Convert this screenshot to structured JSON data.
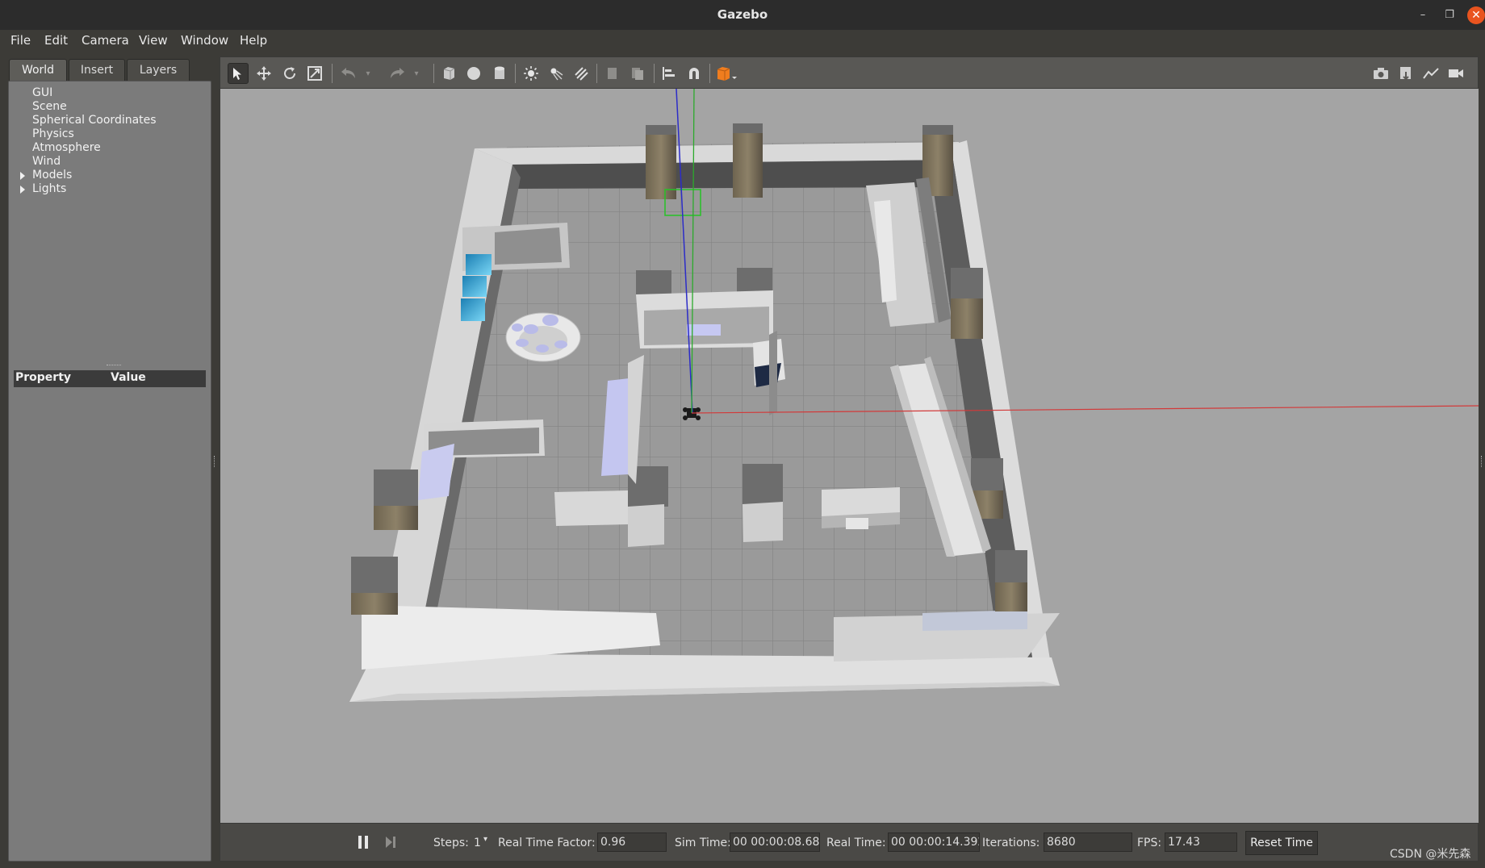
{
  "window": {
    "title": "Gazebo",
    "minimize": "–",
    "restore": "❐",
    "close": "✕"
  },
  "menu": [
    "File",
    "Edit",
    "Camera",
    "View",
    "Window",
    "Help"
  ],
  "left_panel": {
    "tabs": [
      "World",
      "Insert",
      "Layers"
    ],
    "tree": [
      "GUI",
      "Scene",
      "Spherical Coordinates",
      "Physics",
      "Atmosphere",
      "Wind",
      "Models",
      "Lights"
    ],
    "property_header": {
      "property": "Property",
      "value": "Value"
    }
  },
  "bottom_bar": {
    "steps_label": "Steps:",
    "steps_value": "1",
    "rtf_label": "Real Time Factor:",
    "rtf_value": "0.96",
    "sim_time_label": "Sim Time:",
    "sim_time_value": "00 00:00:08.680",
    "real_time_label": "Real Time:",
    "real_time_value": "00 00:00:14.392",
    "iterations_label": "Iterations:",
    "iterations_value": "8680",
    "fps_label": "FPS:",
    "fps_value": "17.43",
    "reset_label": "Reset Time"
  },
  "watermark": "CSDN @米先森",
  "colors": {
    "accent_close": "#e9541f",
    "viewport_bg": "#a4a4a4",
    "panel_bg": "#7b7b7b"
  }
}
